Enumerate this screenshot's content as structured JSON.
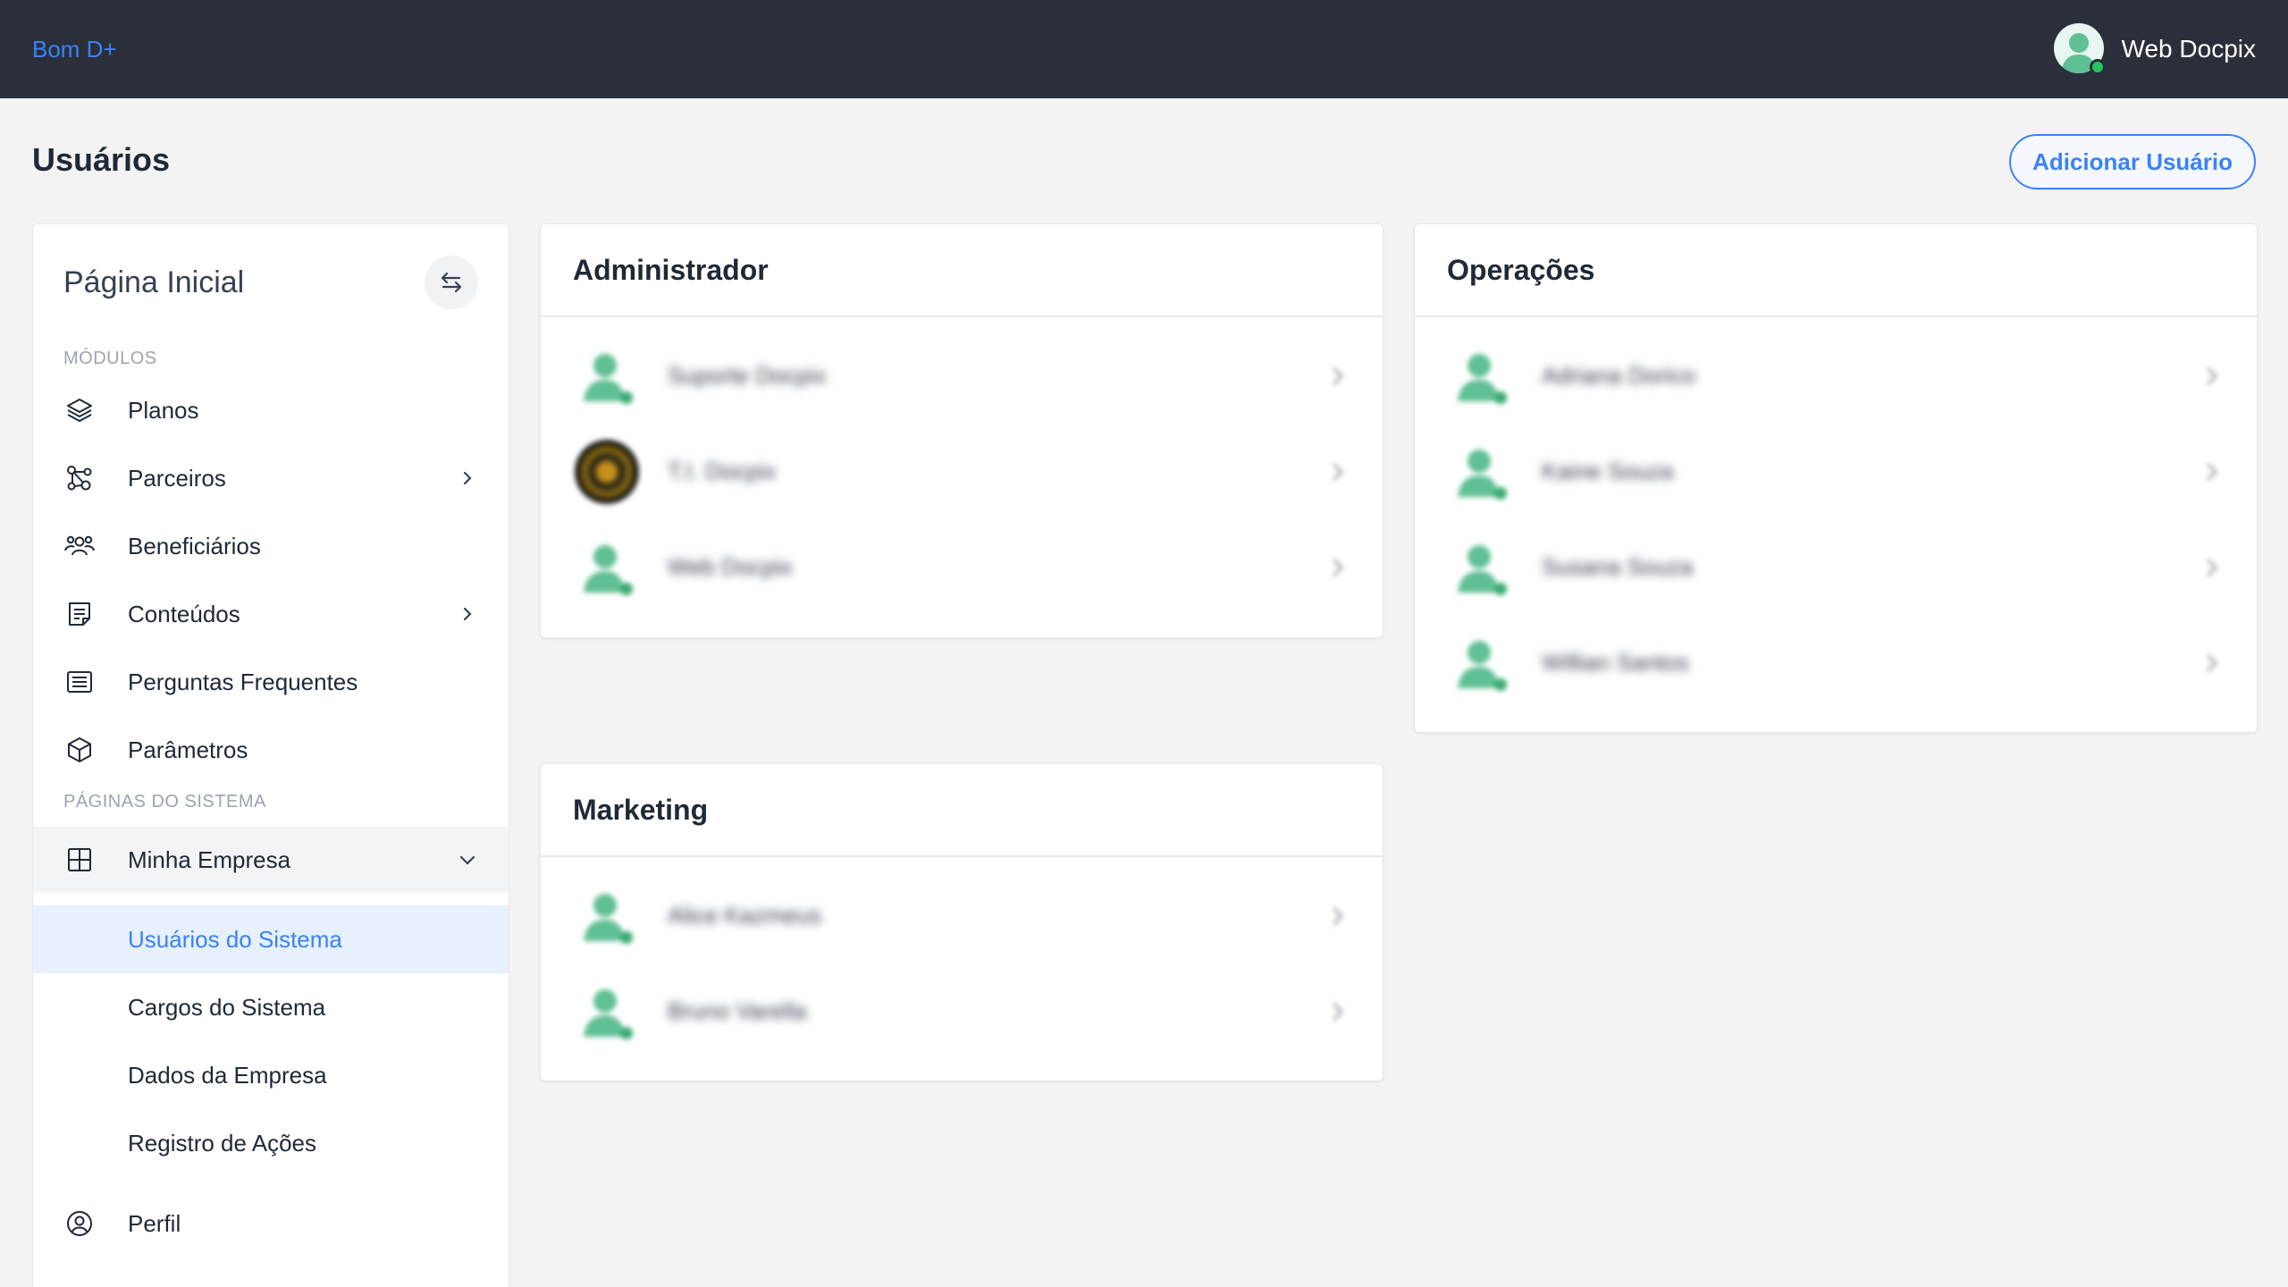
{
  "topbar": {
    "brand": "Bom D+",
    "user_name": "Web Docpix"
  },
  "page": {
    "title": "Usuários",
    "add_button": "Adicionar Usuário"
  },
  "sidebar": {
    "title": "Página Inicial",
    "section_modules": "MÓDULOS",
    "section_pages": "PÁGINAS DO SISTEMA",
    "modules": [
      {
        "label": "Planos",
        "icon": "layers-icon",
        "has_submenu": false
      },
      {
        "label": "Parceiros",
        "icon": "network-icon",
        "has_submenu": true
      },
      {
        "label": "Beneficiários",
        "icon": "users-icon",
        "has_submenu": false
      },
      {
        "label": "Conteúdos",
        "icon": "document-icon",
        "has_submenu": true
      },
      {
        "label": "Perguntas Frequentes",
        "icon": "list-icon",
        "has_submenu": false
      },
      {
        "label": "Parâmetros",
        "icon": "cube-icon",
        "has_submenu": false
      }
    ],
    "company": {
      "label": "Minha Empresa",
      "icon": "grid-icon",
      "expanded": true,
      "subitems": [
        {
          "label": "Usuários do Sistema",
          "active": true
        },
        {
          "label": "Cargos do Sistema",
          "active": false
        },
        {
          "label": "Dados da Empresa",
          "active": false
        },
        {
          "label": "Registro de Ações",
          "active": false
        }
      ]
    },
    "profile": {
      "label": "Perfil",
      "icon": "user-circle-icon"
    }
  },
  "groups": {
    "admin": {
      "title": "Administrador",
      "users": [
        {
          "name": "Suporte Docpix",
          "avatar": "default"
        },
        {
          "name": "T.I. Docpix",
          "avatar": "photo"
        },
        {
          "name": "Web Docpix",
          "avatar": "default"
        }
      ]
    },
    "operacoes": {
      "title": "Operações",
      "users": [
        {
          "name": "Adriana Dorico",
          "avatar": "default"
        },
        {
          "name": "Kaine Souza",
          "avatar": "default"
        },
        {
          "name": "Susana Souza",
          "avatar": "default"
        },
        {
          "name": "Willian Santos",
          "avatar": "default"
        }
      ]
    },
    "marketing": {
      "title": "Marketing",
      "users": [
        {
          "name": "Alice Kazmeus",
          "avatar": "default"
        },
        {
          "name": "Bruno Varella",
          "avatar": "default"
        }
      ]
    }
  },
  "colors": {
    "accent": "#3b82f6",
    "topbar": "#2a2f3a",
    "avatar_green": "#5fbf95",
    "status_online": "#22c55e"
  }
}
